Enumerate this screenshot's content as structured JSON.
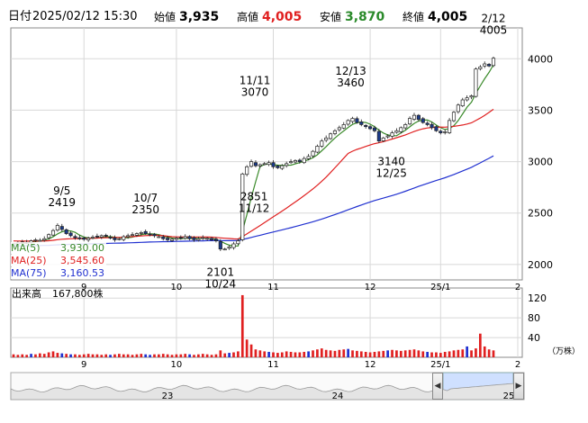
{
  "header": {
    "date_label": "日付",
    "datetime": "2025/02/12 15:30",
    "open_label": "始値",
    "open_value": "3,935",
    "high_label": "高値",
    "high_value": "4,005",
    "low_label": "安値",
    "low_value": "3,870",
    "close_label": "終値",
    "close_value": "4,005"
  },
  "colors": {
    "up_candle": "#ffffff",
    "down_candle": "#1a3a8a",
    "ma5": "#3a8a2a",
    "ma25": "#e02020",
    "ma75": "#2030d0",
    "volume": "#e02020",
    "high_text": "#e02020",
    "low_text": "#2a8a2a"
  },
  "chart_data": [
    {
      "type": "candlestick",
      "y_ticks": [
        2000,
        2500,
        3000,
        3500,
        4000
      ],
      "ylim": [
        1850,
        4300
      ],
      "x_tick_labels": [
        "9",
        "10",
        "11",
        "12",
        "25/1",
        "2"
      ],
      "grid": true,
      "legend_position": "bottom-left",
      "series": [
        {
          "name": "MA(5)",
          "value": "3,930.00"
        },
        {
          "name": "MA(25)",
          "value": "3,545.60"
        },
        {
          "name": "MA(75)",
          "value": "3,160.53"
        }
      ],
      "annotations": [
        {
          "date": "9/5",
          "value": "2419"
        },
        {
          "date": "10/7",
          "value": "2350"
        },
        {
          "date": "10/24",
          "value": "2101"
        },
        {
          "date": "11/11",
          "value": "3070"
        },
        {
          "date": "11/12",
          "value": "2851"
        },
        {
          "date": "12/13",
          "value": "3460"
        },
        {
          "date": "12/25",
          "value": "3140"
        },
        {
          "date": "2/12",
          "value": "4005"
        }
      ],
      "closes": [
        2200,
        2210,
        2220,
        2215,
        2230,
        2240,
        2235,
        2250,
        2290,
        2330,
        2380,
        2340,
        2300,
        2280,
        2260,
        2250,
        2245,
        2255,
        2265,
        2270,
        2280,
        2275,
        2260,
        2240,
        2250,
        2270,
        2280,
        2290,
        2300,
        2310,
        2300,
        2290,
        2280,
        2270,
        2250,
        2240,
        2245,
        2255,
        2260,
        2270,
        2250,
        2240,
        2250,
        2260,
        2255,
        2240,
        2230,
        2150,
        2150,
        2170,
        2200,
        2230,
        2880,
        2950,
        3000,
        2960,
        2970,
        2980,
        2990,
        2950,
        2940,
        2960,
        2980,
        3000,
        3010,
        3000,
        3030,
        3050,
        3100,
        3150,
        3200,
        3230,
        3270,
        3300,
        3330,
        3360,
        3400,
        3420,
        3380,
        3360,
        3340,
        3320,
        3300,
        3200,
        3230,
        3250,
        3280,
        3300,
        3330,
        3360,
        3420,
        3450,
        3410,
        3380,
        3360,
        3330,
        3300,
        3280,
        3290,
        3400,
        3480,
        3550,
        3600,
        3620,
        3640,
        3900,
        3920,
        3950,
        3930,
        4005
      ],
      "volume": {
        "label": "出来高",
        "latest": "167,800株",
        "unit": "（万株）",
        "y_ticks": [
          40,
          80,
          120
        ],
        "ylim": [
          0,
          135
        ],
        "values": [
          6,
          5,
          6,
          5,
          7,
          6,
          8,
          7,
          10,
          12,
          9,
          8,
          7,
          6,
          6,
          5,
          6,
          7,
          6,
          6,
          5,
          6,
          5,
          6,
          7,
          6,
          6,
          5,
          6,
          7,
          6,
          5,
          6,
          6,
          7,
          6,
          5,
          6,
          6,
          7,
          6,
          5,
          6,
          7,
          6,
          5,
          6,
          14,
          8,
          9,
          10,
          12,
          126,
          36,
          26,
          16,
          14,
          12,
          11,
          10,
          9,
          10,
          12,
          11,
          10,
          10,
          11,
          12,
          14,
          16,
          18,
          15,
          14,
          13,
          15,
          16,
          17,
          14,
          13,
          12,
          11,
          10,
          11,
          12,
          13,
          14,
          15,
          14,
          13,
          14,
          15,
          16,
          14,
          12,
          11,
          10,
          10,
          9,
          11,
          12,
          14,
          15,
          16,
          22,
          14,
          18,
          48,
          22,
          16,
          14
        ]
      }
    },
    {
      "type": "area",
      "x_tick_labels": [
        "23",
        "24",
        "25"
      ]
    }
  ]
}
